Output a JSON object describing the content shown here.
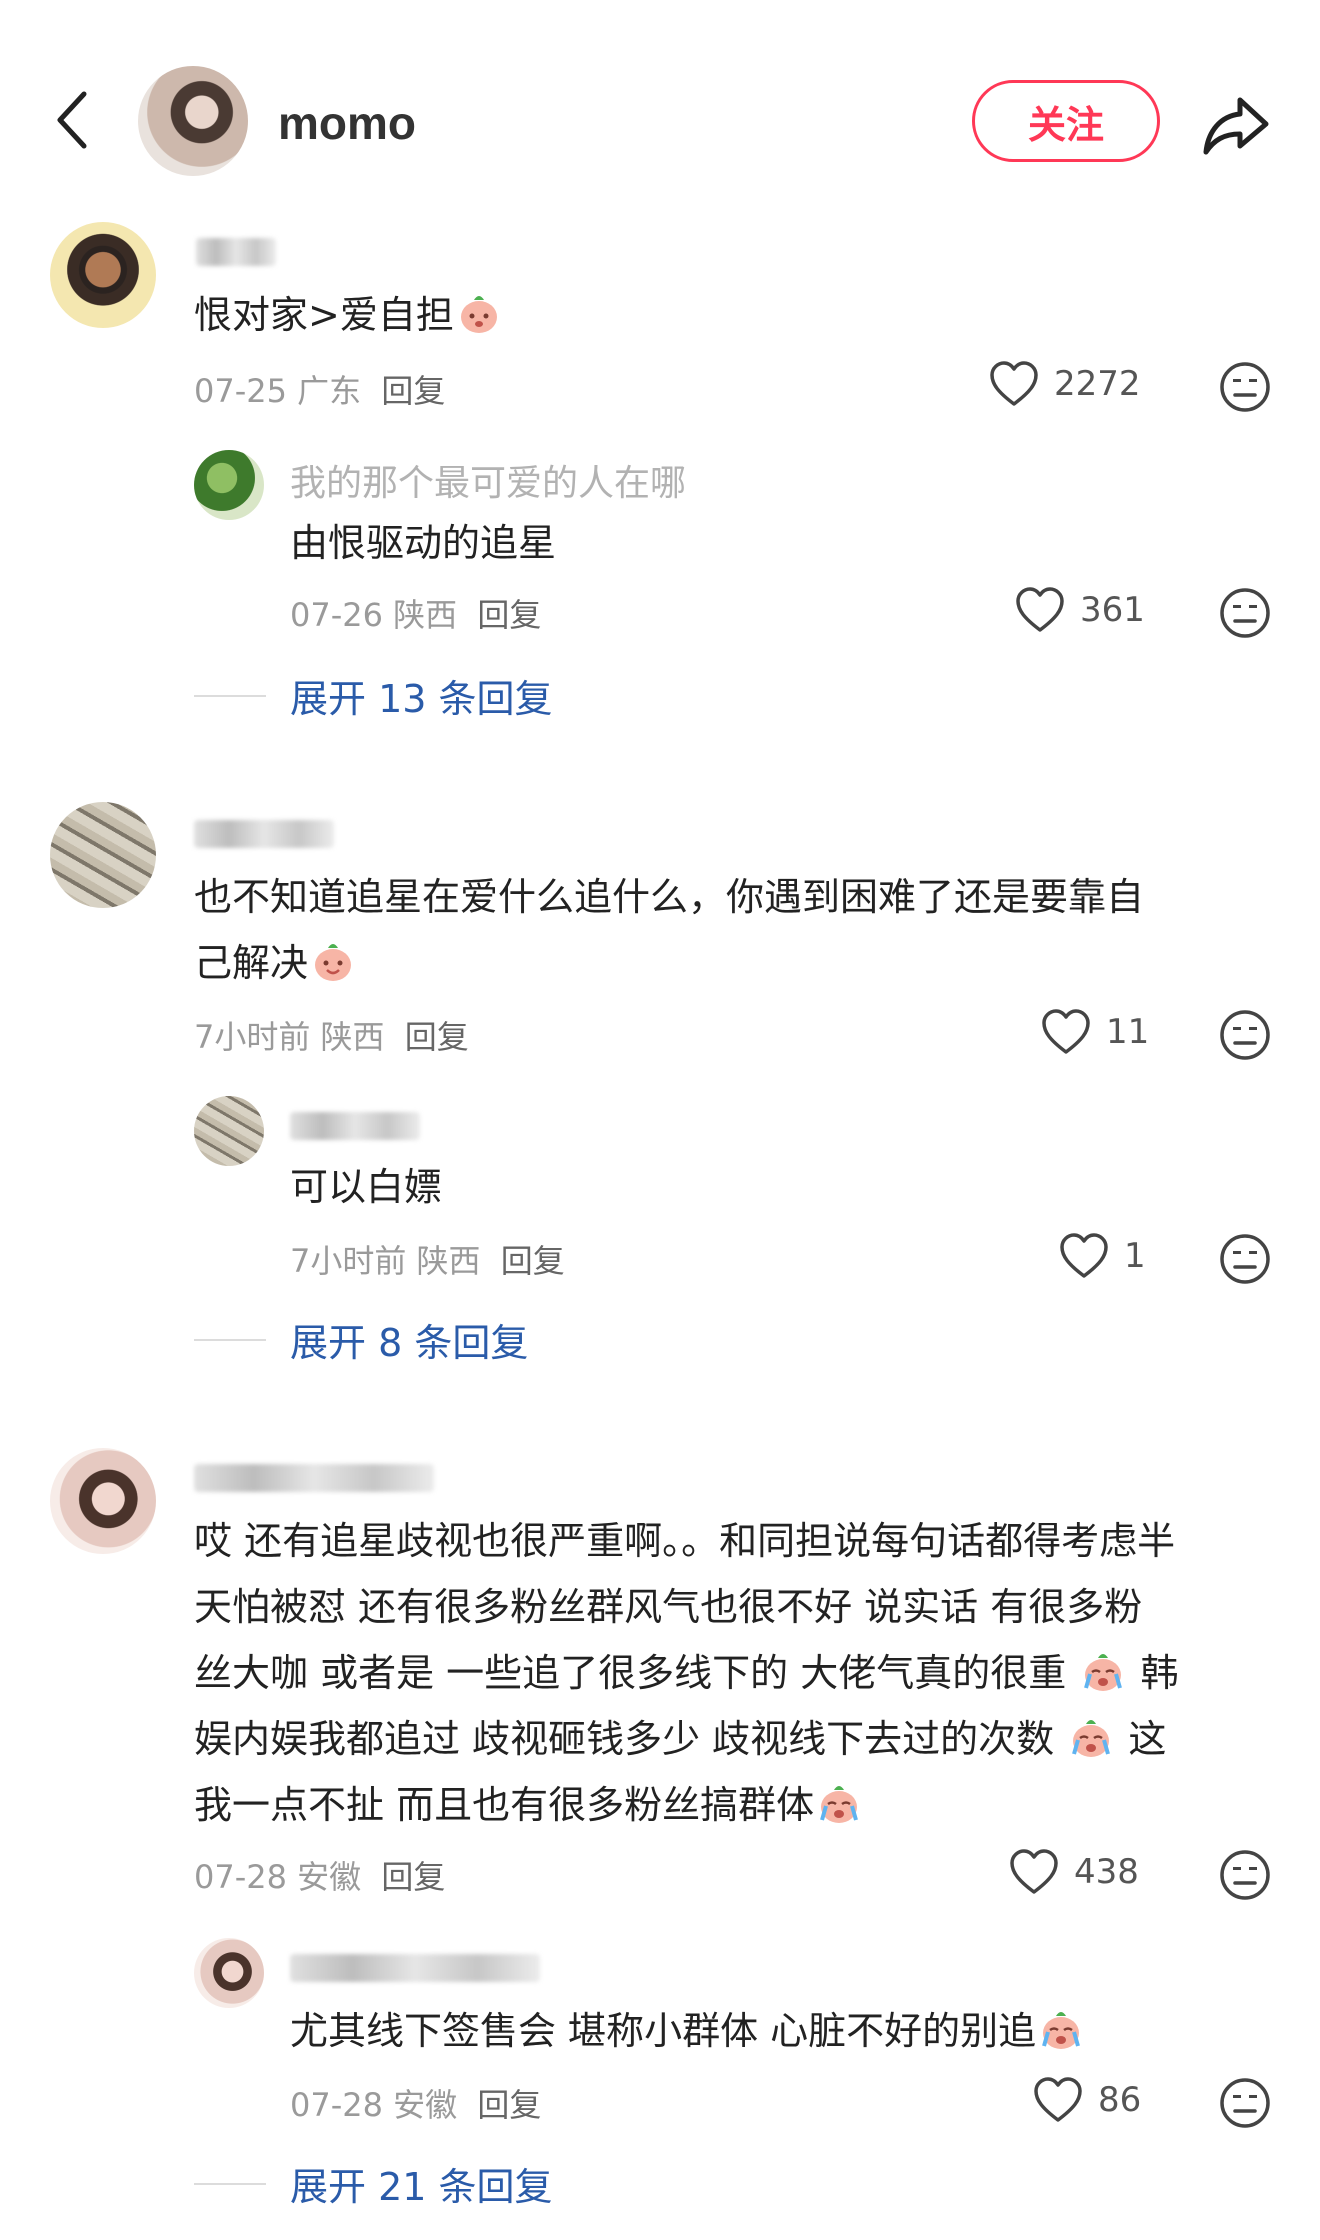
{
  "header": {
    "name": "momo",
    "follow_label": "关注"
  },
  "comments": [
    {
      "text_parts": [
        "恨对家>爱自担"
      ],
      "date": "07-25",
      "location": "广东",
      "reply_label": "回复",
      "likes": "2272",
      "reply": {
        "username": "我的那个最可爱的人在哪",
        "text": "由恨驱动的追星",
        "date": "07-26",
        "location": "陕西",
        "reply_label": "回复",
        "likes": "361"
      },
      "expand_label": "展开 13 条回复"
    },
    {
      "text_parts": [
        "也不知道追星在爱什么追什么，你遇到困难了还是要靠自",
        "己解决"
      ],
      "date": "7小时前",
      "location": "陕西",
      "reply_label": "回复",
      "likes": "11",
      "reply": {
        "text": "可以白嫖",
        "date": "7小时前",
        "location": "陕西",
        "reply_label": "回复",
        "likes": "1"
      },
      "expand_label": "展开 8 条回复"
    },
    {
      "text_parts": [
        "哎 还有追星歧视也很严重啊。。和同担说每句话都得考虑半",
        "天怕被怼  还有很多粉丝群风气也很不好 说实话 有很多粉",
        "丝大咖  或者是 一些追了很多线下的 大佬气真的很重",
        "韩",
        "娱内娱我都追过 歧视砸钱多少 歧视线下去过的次数",
        "这",
        "我一点不扯 而且也有很多粉丝搞群体"
      ],
      "date": "07-28",
      "location": "安徽",
      "reply_label": "回复",
      "likes": "438",
      "reply": {
        "text": "尤其线下签售会 堪称小群体 心脏不好的别追",
        "date": "07-28",
        "location": "安徽",
        "reply_label": "回复",
        "likes": "86"
      },
      "expand_label": "展开 21 条回复"
    }
  ],
  "icons": {
    "back": "chevron-left-icon",
    "share": "share-arrow-icon",
    "like": "heart-outline-icon",
    "dislike": "meh-face-icon",
    "emoji": "peach-emoji"
  },
  "colors": {
    "accent": "#ff3856",
    "link": "#2a5ba9",
    "muted": "#9a9a9a"
  }
}
